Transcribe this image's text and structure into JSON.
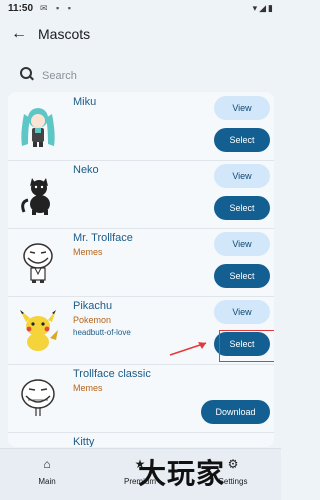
{
  "status": {
    "time": "11:50"
  },
  "appbar": {
    "title": "Mascots"
  },
  "search": {
    "placeholder": "Search"
  },
  "mascots": [
    {
      "name": "Miku",
      "category": "",
      "subtitle": "",
      "view_label": "View",
      "action_label": "Select"
    },
    {
      "name": "Neko",
      "category": "",
      "subtitle": "",
      "view_label": "View",
      "action_label": "Select"
    },
    {
      "name": "Mr. Trollface",
      "category": "Memes",
      "subtitle": "",
      "view_label": "View",
      "action_label": "Select"
    },
    {
      "name": "Pikachu",
      "category": "Pokemon",
      "subtitle": "headbutt-of-love",
      "view_label": "View",
      "action_label": "Select"
    },
    {
      "name": "Trollface classic",
      "category": "Memes",
      "subtitle": "",
      "action_label": "Download"
    },
    {
      "name": "Kitty"
    }
  ],
  "nav": {
    "items": [
      {
        "label": "Main"
      },
      {
        "label": "Premium"
      },
      {
        "label": "Settings"
      }
    ]
  },
  "watermark": {
    "text": "大玩家"
  },
  "colors": {
    "primary": "#145f91",
    "tonal": "#d3e7fa",
    "category": "#b5641a",
    "highlight": "#e23a3a"
  }
}
